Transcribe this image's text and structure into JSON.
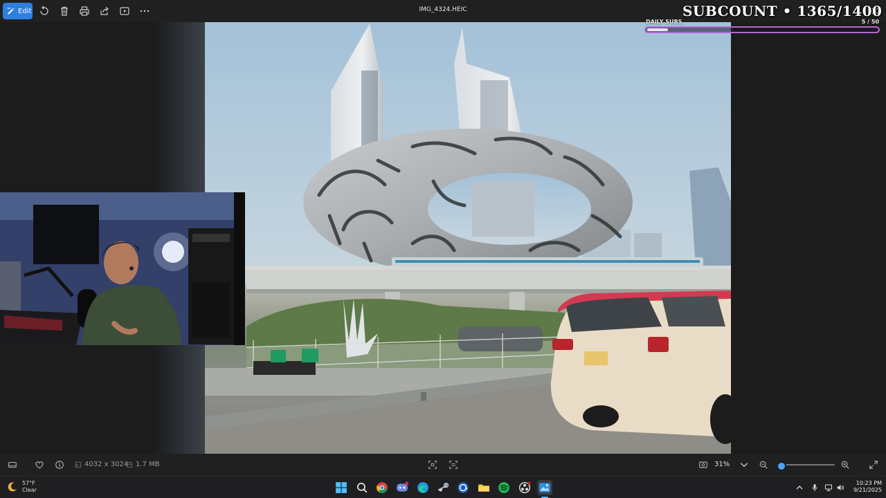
{
  "toolbar": {
    "edit_label": "Edit",
    "file_name": "IMG_4324.HEIC"
  },
  "overlay": {
    "subcount_text": "SUBCOUNT • 1365/1400",
    "daily_label": "DAILY SUBS",
    "daily_count": "5 / 50",
    "daily_progress": 0.1,
    "accent": "#b566d8"
  },
  "infobar": {
    "dimensions": "4032 x 3024",
    "file_size": "1.7 MB",
    "zoom": "31%",
    "zoom_level": 0.06
  },
  "taskbar": {
    "temperature": "57°F",
    "condition": "Clear",
    "time": "10:23 PM",
    "date": "9/21/2025",
    "apps": [
      "windows-start-icon",
      "search-icon",
      "chrome-icon",
      "discord-icon",
      "edge-icon",
      "steam-icon",
      "email-icon",
      "file-explorer-icon",
      "spotify-icon",
      "obs-icon",
      "photos-icon"
    ]
  },
  "colors": {
    "edit_accent": "#2e7fe0",
    "zoom_accent": "#4aa3ff"
  }
}
